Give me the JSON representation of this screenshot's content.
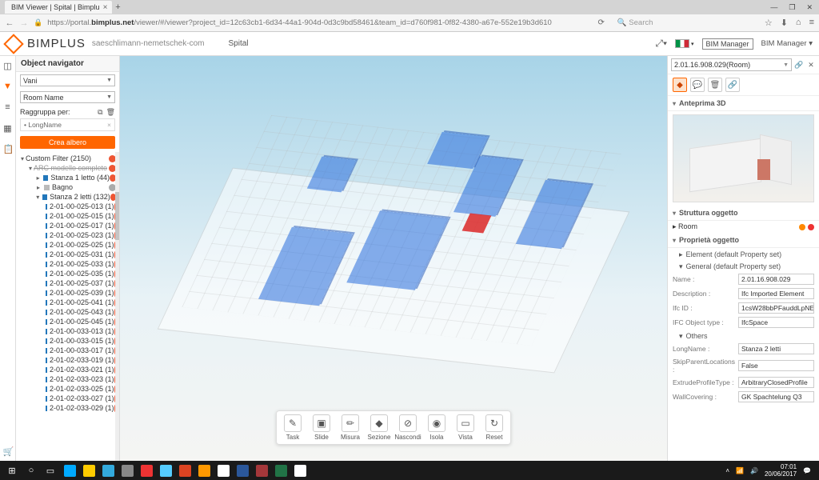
{
  "browser": {
    "tab_title": "BIM Viewer | Spital | Bimplu",
    "url_prefix": "https://portal.",
    "url_host": "bimplus.net",
    "url_path": "/viewer/#/viewer?project_id=12c63cb1-6d34-44a1-904d-0d3c9bd58461&team_id=d760f981-0f82-4380-a67e-552e19b3d610",
    "search_placeholder": "Search"
  },
  "header": {
    "brand": "BIMPLUS",
    "team": "saeschlimann-nemetschek-com",
    "project": "Spital",
    "role_badge": "BIM Manager",
    "role_menu": "BIM Manager"
  },
  "nav": {
    "title": "Object navigator",
    "select1": "Vani",
    "select2": "Room Name",
    "group_label": "Raggruppa per:",
    "chip": "LongName",
    "create_btn": "Crea albero",
    "root": "Custom Filter  (2150)",
    "model": "ARC modello completo",
    "cat1": "Stanza 1 letto  (44)",
    "cat2": "Bagno",
    "cat3": "Stanza 2 letti  (132)",
    "items": [
      "2-01-00-025-013  (1)",
      "2-01-00-025-015  (1)",
      "2-01-00-025-017  (1)",
      "2-01-00-025-023  (1)",
      "2-01-00-025-025  (1)",
      "2-01-00-025-031  (1)",
      "2-01-00-025-033  (1)",
      "2-01-00-025-035  (1)",
      "2-01-00-025-037  (1)",
      "2-01-00-025-039  (1)",
      "2-01-00-025-041  (1)",
      "2-01-00-025-043  (1)",
      "2-01-00-025-045  (1)",
      "2-01-00-033-013  (1)",
      "2-01-00-033-015  (1)",
      "2-01-00-033-017  (1)",
      "2-01-02-033-019  (1)",
      "2-01-02-033-021  (1)",
      "2-01-02-033-023  (1)",
      "2-01-02-033-025  (1)",
      "2-01-02-033-027  (1)",
      "2-01-02-033-029  (1)"
    ]
  },
  "tools": {
    "task": "Task",
    "slide": "Slide",
    "misura": "Misura",
    "sezione": "Sezione",
    "nascondi": "Nascondi",
    "isola": "Isola",
    "vista": "Vista",
    "reset": "Reset"
  },
  "right": {
    "selected": "2.01.16.908.029(Room)",
    "sect_preview": "Anteprima 3D",
    "sect_struct": "Struttura oggetto",
    "struct_item": "Room",
    "sect_props": "Proprietà oggetto",
    "sub_element": "Element (default Property set)",
    "sub_general": "General (default Property set)",
    "sub_others": "Others",
    "props_general": [
      {
        "l": "Name :",
        "v": "2.01.16.908.029"
      },
      {
        "l": "Description :",
        "v": "Ifc Imported Element"
      },
      {
        "l": "Ifc ID :",
        "v": "1csW28bbPFauddLpNE..."
      },
      {
        "l": "IFC Object type :",
        "v": "IfcSpace"
      }
    ],
    "props_others": [
      {
        "l": "LongName :",
        "v": "Stanza 2 letti"
      },
      {
        "l": "SkipParentLocations :",
        "v": "False"
      },
      {
        "l": "ExtrudeProfileType :",
        "v": "ArbitraryClosedProfile"
      },
      {
        "l": "WallCovering :",
        "v": "GK Spachtelung Q3"
      }
    ]
  },
  "taskbar": {
    "time": "07:01",
    "date": "20/06/2017"
  }
}
